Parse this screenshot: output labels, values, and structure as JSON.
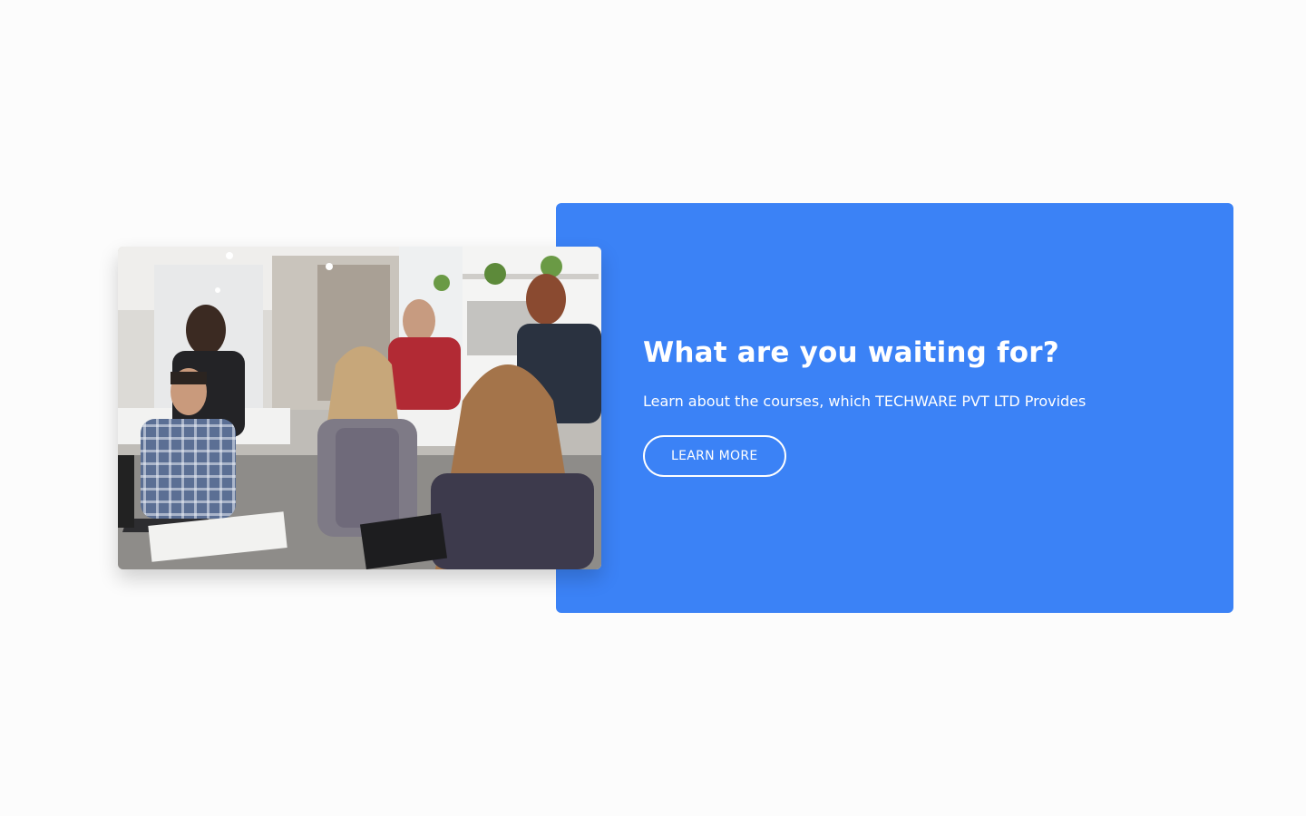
{
  "cta": {
    "title": "What are you waiting for?",
    "subtitle": "Learn about the courses, which TECHWARE PVT LTD Provides",
    "button_label": "LEARN MORE"
  },
  "photo": {
    "subject": "team-meeting-photo"
  },
  "colors": {
    "panel": "#3b82f6",
    "text": "#ffffff",
    "page_background": "#fcfcfc"
  }
}
